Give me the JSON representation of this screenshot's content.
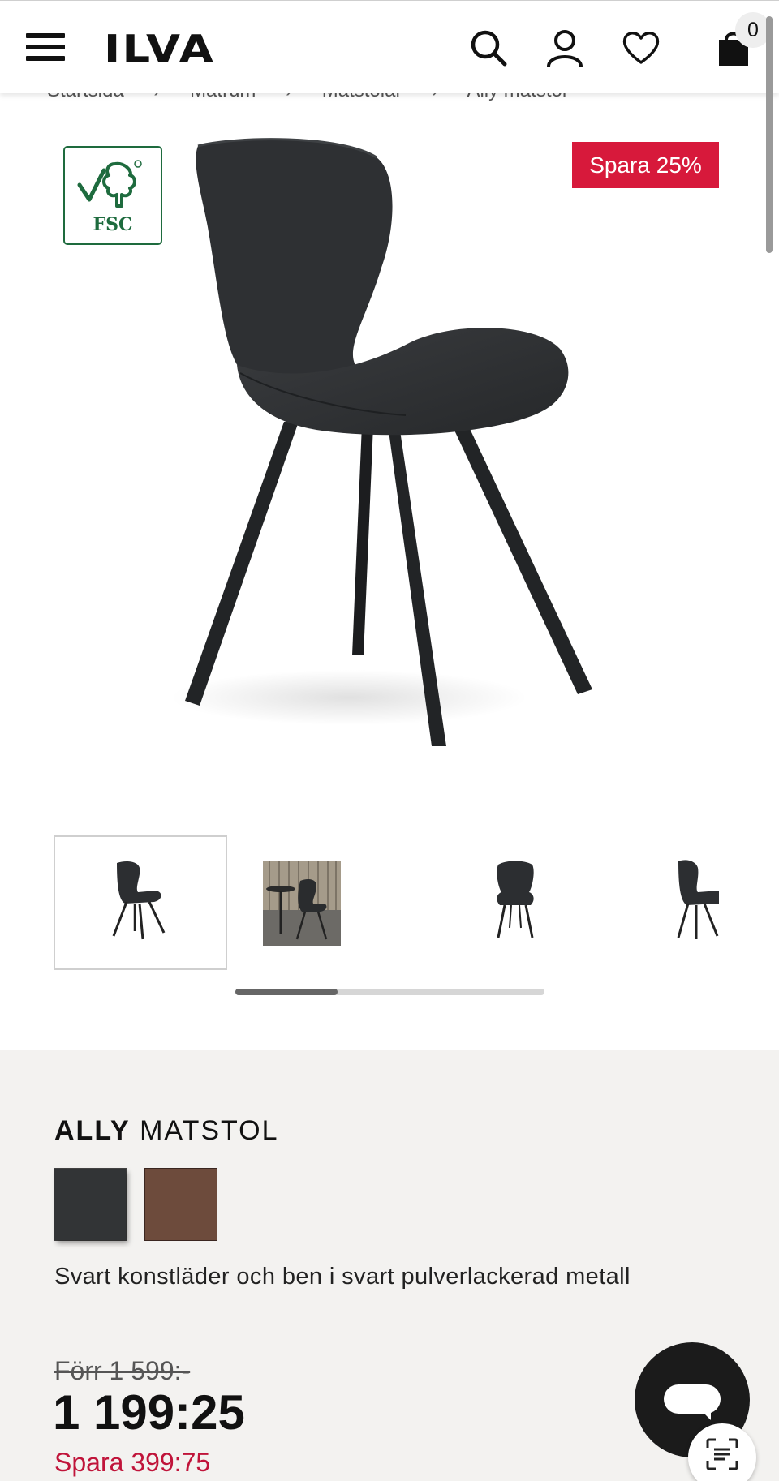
{
  "header": {
    "logo": "ILVA",
    "cart_count": "0"
  },
  "breadcrumb": {
    "items": [
      "Startsida",
      "Matrum",
      "Matstolar",
      "Ally matstol"
    ],
    "separator": "›"
  },
  "badges": {
    "certification": "FSC",
    "sale": "Spara 25%"
  },
  "gallery": {
    "thumbnail_count": 4,
    "active_index": 0,
    "scroll_position_fraction": 0.33
  },
  "product": {
    "name_bold": "ALLY",
    "name_rest": "MATSTOL",
    "colors": [
      {
        "name": "black",
        "hex": "#323436",
        "selected": true
      },
      {
        "name": "brown",
        "hex": "#6d4b3c",
        "selected": false
      }
    ],
    "color_description": "Svart konstläder och ben i svart pulverlackerad metall",
    "old_price": "Förr 1 599:-",
    "price": "1 199:25",
    "saving": "Spara 399:75"
  },
  "colors": {
    "sale_red": "#d7193b",
    "saving_text": "#c0143a",
    "fsc_green": "#1e6b3e",
    "info_background": "#f3f2f0"
  },
  "icons": [
    "menu-icon",
    "search-icon",
    "account-icon",
    "heart-icon",
    "shopping-bag-icon",
    "chat-icon",
    "scan-text-icon"
  ]
}
